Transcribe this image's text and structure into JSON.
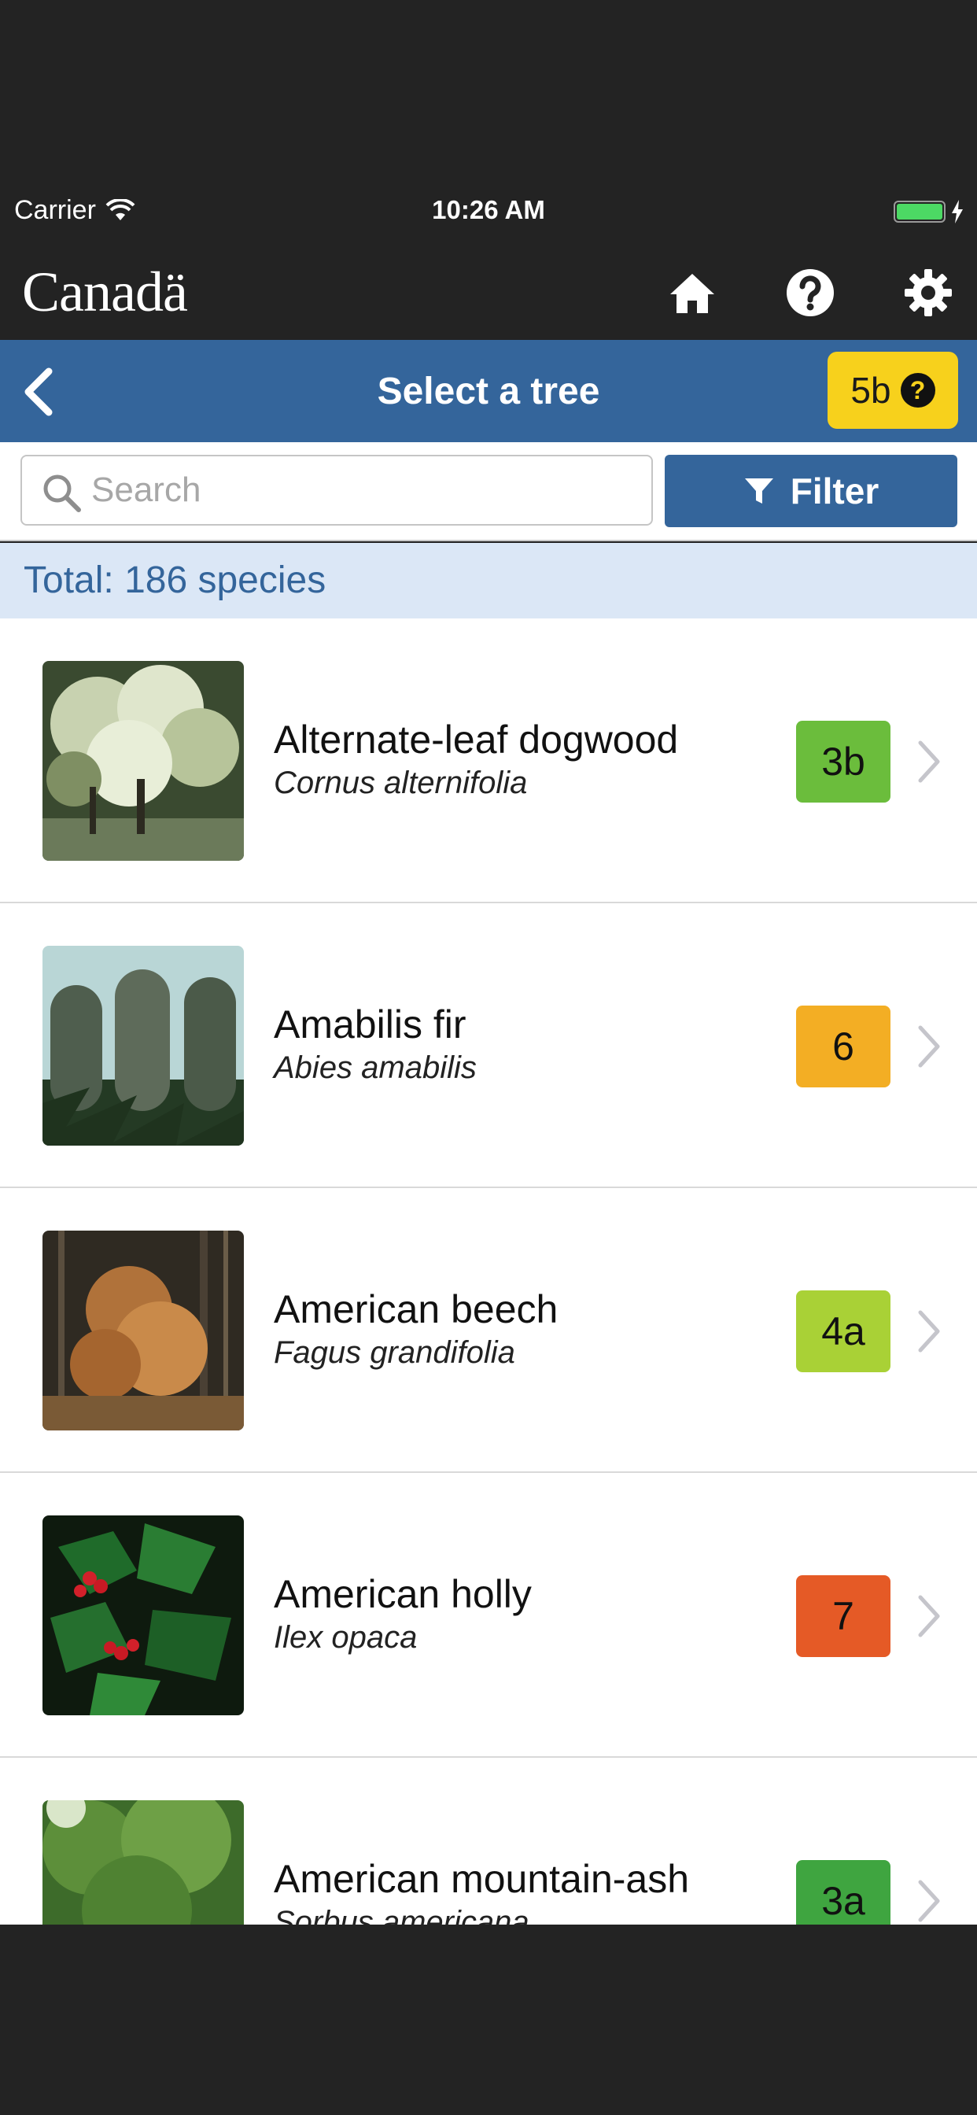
{
  "status_bar": {
    "carrier": "Carrier",
    "time": "10:26 AM",
    "battery_color": "#4cd964"
  },
  "header": {
    "logo_text": "Canadä",
    "icons": [
      "home-icon",
      "help-icon",
      "gear-icon"
    ]
  },
  "title_bar": {
    "title": "Select a tree",
    "zone_badge": "5b",
    "zone_badge_color": "#f7d11c",
    "bar_color": "#34659b"
  },
  "search": {
    "placeholder": "Search",
    "value": ""
  },
  "filter": {
    "label": "Filter"
  },
  "summary": {
    "total_text": "Total: 186 species"
  },
  "species": [
    {
      "common": "Alternate-leaf dogwood",
      "scientific": "Cornus alternifolia",
      "zone": "3b",
      "zone_color": "#6bbd3c"
    },
    {
      "common": "Amabilis fir",
      "scientific": "Abies amabilis",
      "zone": "6",
      "zone_color": "#f3ae24"
    },
    {
      "common": "American beech",
      "scientific": "Fagus grandifolia",
      "zone": "4a",
      "zone_color": "#a9d136"
    },
    {
      "common": "American holly",
      "scientific": "Ilex opaca",
      "zone": "7",
      "zone_color": "#e55a26"
    },
    {
      "common": "American mountain-ash",
      "scientific": "Sorbus americana",
      "zone": "3a",
      "zone_color": "#3fa540"
    }
  ]
}
